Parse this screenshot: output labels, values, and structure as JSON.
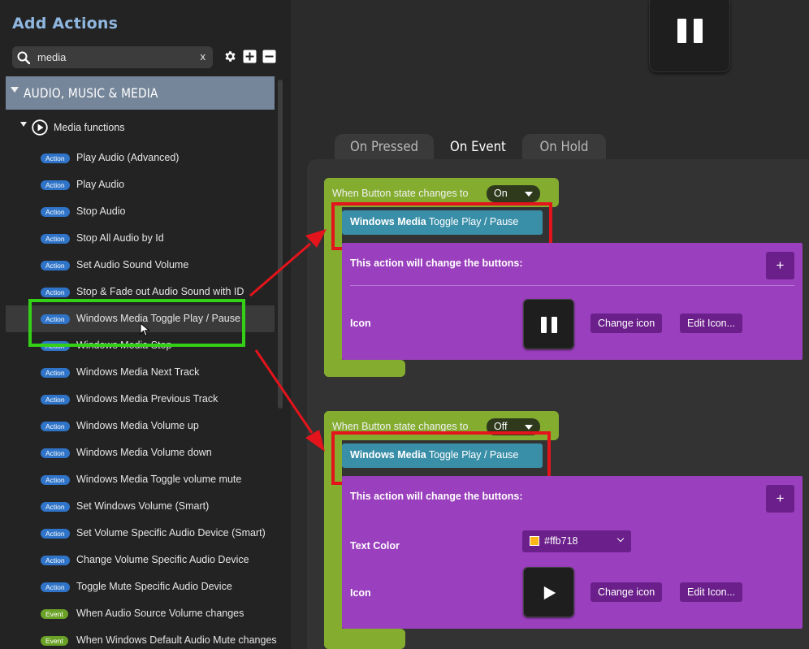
{
  "sidebar": {
    "title": "Add Actions",
    "search": {
      "value": "media",
      "clear_label": "x"
    },
    "toolbar_icons": [
      "gear-icon",
      "plus-square-icon",
      "minus-square-icon"
    ],
    "category": "AUDIO, MUSIC & MEDIA",
    "subcategory": "Media functions",
    "items": [
      {
        "badge": "Action",
        "label": "Play Audio (Advanced)"
      },
      {
        "badge": "Action",
        "label": "Play Audio"
      },
      {
        "badge": "Action",
        "label": "Stop Audio"
      },
      {
        "badge": "Action",
        "label": "Stop All Audio by Id"
      },
      {
        "badge": "Action",
        "label": "Set Audio Sound Volume"
      },
      {
        "badge": "Action",
        "label": "Stop & Fade out Audio Sound with ID"
      },
      {
        "badge": "Action",
        "label": "Windows Media Toggle Play / Pause"
      },
      {
        "badge": "Action",
        "label": "Windows Media Stop"
      },
      {
        "badge": "Action",
        "label": "Windows Media Next Track"
      },
      {
        "badge": "Action",
        "label": "Windows Media Previous Track"
      },
      {
        "badge": "Action",
        "label": "Windows Media Volume up"
      },
      {
        "badge": "Action",
        "label": "Windows Media Volume down"
      },
      {
        "badge": "Action",
        "label": "Windows Media Toggle volume mute"
      },
      {
        "badge": "Action",
        "label": "Set Windows Volume (Smart)"
      },
      {
        "badge": "Action",
        "label": "Set Volume Specific Audio Device (Smart)"
      },
      {
        "badge": "Action",
        "label": "Change Volume Specific Audio Device"
      },
      {
        "badge": "Action",
        "label": "Toggle Mute Specific Audio Device"
      },
      {
        "badge": "Event",
        "label": "When Audio Source Volume changes"
      },
      {
        "badge": "Event",
        "label": "When Windows Default Audio Mute changes"
      }
    ]
  },
  "tabs": [
    {
      "label": "On Pressed"
    },
    {
      "label": "On Event"
    },
    {
      "label": "On Hold"
    }
  ],
  "events": [
    {
      "condition": "When Button state changes to",
      "state": "On",
      "action": {
        "bold": "Windows Media",
        "rest": " Toggle Play / Pause"
      },
      "change_heading": "This action will change the buttons:",
      "add_label": "+",
      "icon_label": "Icon",
      "change_icon": "Change icon",
      "edit_icon": "Edit Icon...",
      "icon_glyph": "pause-icon"
    },
    {
      "condition": "When Button state changes to",
      "state": "Off",
      "action": {
        "bold": "Windows Media",
        "rest": " Toggle Play / Pause"
      },
      "change_heading": "This action will change the buttons:",
      "add_label": "+",
      "text_color_label": "Text Color",
      "text_color_value": "#ffb718",
      "icon_label": "Icon",
      "change_icon": "Change icon",
      "edit_icon": "Edit Icon...",
      "icon_glyph": "play-icon"
    }
  ],
  "colors": {
    "accent_blue": "#2f74c8",
    "event_green": "#84ad30",
    "action_teal": "#3a8fa8",
    "purple": "#9a3fbd",
    "highlight_green": "#34d017",
    "highlight_red": "#e3141b"
  }
}
